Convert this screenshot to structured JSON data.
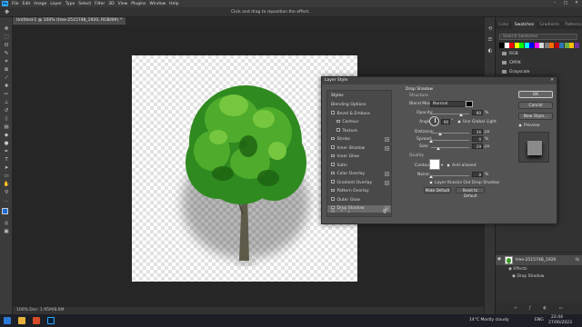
{
  "menubar": {
    "app_logo": "Ps",
    "items": [
      "File",
      "Edit",
      "Image",
      "Layer",
      "Type",
      "Select",
      "Filter",
      "3D",
      "View",
      "Plugins",
      "Window",
      "Help"
    ]
  },
  "optionsbar": {
    "hint": "Click and drag to reposition the effect."
  },
  "document": {
    "tab_title": "Untitled-1 @ 100% (tree-2515748_1920, RGB/8#) *",
    "status": "100%   Doc: 1.95M/8.6M"
  },
  "dialog": {
    "title": "Layer Style",
    "list_header": "Styles",
    "list_items": [
      {
        "label": "Blending Options",
        "checkbox": false,
        "plus": false,
        "selected": false
      },
      {
        "label": "Bevel & Emboss",
        "checkbox": true,
        "plus": false,
        "selected": false
      },
      {
        "label": "Contour",
        "checkbox": true,
        "plus": false,
        "selected": false,
        "indent": true
      },
      {
        "label": "Texture",
        "checkbox": true,
        "plus": false,
        "selected": false,
        "indent": true
      },
      {
        "label": "Stroke",
        "checkbox": true,
        "plus": true,
        "selected": false
      },
      {
        "label": "Inner Shadow",
        "checkbox": true,
        "plus": true,
        "selected": false
      },
      {
        "label": "Inner Glow",
        "checkbox": true,
        "plus": false,
        "selected": false
      },
      {
        "label": "Satin",
        "checkbox": true,
        "plus": false,
        "selected": false
      },
      {
        "label": "Color Overlay",
        "checkbox": true,
        "plus": true,
        "selected": false
      },
      {
        "label": "Gradient Overlay",
        "checkbox": true,
        "plus": true,
        "selected": false
      },
      {
        "label": "Pattern Overlay",
        "checkbox": true,
        "plus": false,
        "selected": false
      },
      {
        "label": "Outer Glow",
        "checkbox": true,
        "plus": false,
        "selected": false
      },
      {
        "label": "Drop Shadow",
        "checkbox": true,
        "plus": true,
        "selected": true
      }
    ],
    "section_title": "Drop Shadow",
    "structure_label": "Structure",
    "blend_mode_label": "Blend Mode:",
    "blend_mode_value": "Normal",
    "shadow_color": "#000000",
    "opacity_label": "Opacity:",
    "opacity_value": "80",
    "angle_label": "Angle:",
    "angle_value": "90",
    "global_light_label": "Use Global Light",
    "distance_label": "Distance:",
    "distance_value": "26",
    "spread_label": "Spread:",
    "spread_value": "0",
    "size_label": "Size:",
    "size_value": "29",
    "unit_percent": "%",
    "unit_px": "px",
    "quality_label": "Quality",
    "contour_label": "Contour:",
    "anti_aliased_label": "Anti-aliased",
    "noise_label": "Noise:",
    "noise_value": "0",
    "knockout_label": "Layer Knocks Out Drop Shadow",
    "make_default": "Make Default",
    "reset_default": "Reset to Default",
    "ok": "OK",
    "cancel": "Cancel",
    "new_style": "New Style...",
    "preview_label": "Preview",
    "footer_fx": "fx"
  },
  "swatches_panel": {
    "tabs": [
      "Color",
      "Swatches",
      "Gradients",
      "Patterns"
    ],
    "search_placeholder": "Search Swatches",
    "folders": [
      "RGB",
      "CMYK",
      "Grayscale"
    ],
    "colors": [
      "#000000",
      "#ffffff",
      "#ff0000",
      "#ffff00",
      "#00ff00",
      "#00ffff",
      "#0000ff",
      "#ff00ff",
      "#d9d9d9",
      "#7f7f7f",
      "#ff6e00",
      "#c00000",
      "#2e75b6",
      "#70ad47",
      "#ffc000",
      "#7030a0"
    ]
  },
  "layers_panel": {
    "layer_name": "tree-2515748_1920",
    "effects_label": "Effects",
    "effect_item": "Drop Shadow",
    "fx": "fx"
  },
  "taskbar": {
    "weather": "14°C  Mostly cloudy",
    "lang": "ENG",
    "time": "22:44",
    "date": "27/06/2023"
  }
}
